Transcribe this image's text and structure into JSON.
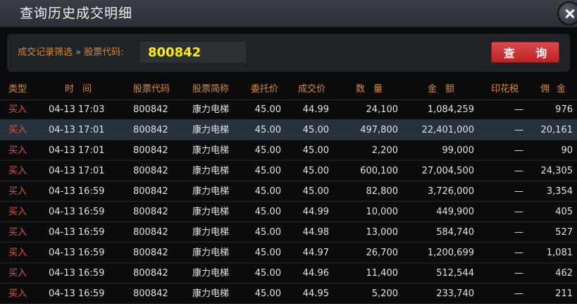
{
  "window": {
    "title": "查询历史成交明细",
    "close_icon": "close-icon"
  },
  "filter": {
    "label": "成交记录筛选",
    "separator": " » ",
    "code_label": "股票代码:",
    "code_value": "800842",
    "query_label": "查 询"
  },
  "colors": {
    "accent_orange": "#d88a3a",
    "buy_red": "#e0574a",
    "code_yellow": "#ffee00",
    "button_red": "#d03434",
    "selected_row": "#27313c"
  },
  "table": {
    "columns": [
      "类型",
      "时间",
      "股票代码",
      "股票简称",
      "委托价",
      "成交价",
      "数量",
      "金额",
      "印花税",
      "佣金"
    ],
    "rows": [
      {
        "type": "买入",
        "time": "04-13 17:03",
        "code": "800842",
        "name": "康力电梯",
        "order_price": "45.00",
        "deal_price": "44.99",
        "qty": "24,100",
        "amount": "1,084,259",
        "tax": "—",
        "commission": "976"
      },
      {
        "type": "买入",
        "time": "04-13 17:01",
        "code": "800842",
        "name": "康力电梯",
        "order_price": "45.00",
        "deal_price": "45.00",
        "qty": "497,800",
        "amount": "22,401,000",
        "tax": "—",
        "commission": "20,161"
      },
      {
        "type": "买入",
        "time": "04-13 17:01",
        "code": "800842",
        "name": "康力电梯",
        "order_price": "45.00",
        "deal_price": "45.00",
        "qty": "2,200",
        "amount": "99,000",
        "tax": "—",
        "commission": "90"
      },
      {
        "type": "买入",
        "time": "04-13 17:01",
        "code": "800842",
        "name": "康力电梯",
        "order_price": "45.00",
        "deal_price": "45.00",
        "qty": "600,100",
        "amount": "27,004,500",
        "tax": "—",
        "commission": "24,305"
      },
      {
        "type": "买入",
        "time": "04-13 16:59",
        "code": "800842",
        "name": "康力电梯",
        "order_price": "45.00",
        "deal_price": "45.00",
        "qty": "82,800",
        "amount": "3,726,000",
        "tax": "—",
        "commission": "3,354"
      },
      {
        "type": "买入",
        "time": "04-13 16:59",
        "code": "800842",
        "name": "康力电梯",
        "order_price": "45.00",
        "deal_price": "44.99",
        "qty": "10,000",
        "amount": "449,900",
        "tax": "—",
        "commission": "405"
      },
      {
        "type": "买入",
        "time": "04-13 16:59",
        "code": "800842",
        "name": "康力电梯",
        "order_price": "45.00",
        "deal_price": "44.98",
        "qty": "13,000",
        "amount": "584,740",
        "tax": "—",
        "commission": "527"
      },
      {
        "type": "买入",
        "time": "04-13 16:59",
        "code": "800842",
        "name": "康力电梯",
        "order_price": "45.00",
        "deal_price": "44.97",
        "qty": "26,700",
        "amount": "1,200,699",
        "tax": "—",
        "commission": "1,081"
      },
      {
        "type": "买入",
        "time": "04-13 16:59",
        "code": "800842",
        "name": "康力电梯",
        "order_price": "45.00",
        "deal_price": "44.96",
        "qty": "11,400",
        "amount": "512,544",
        "tax": "—",
        "commission": "462"
      },
      {
        "type": "买入",
        "time": "04-13 16:59",
        "code": "800842",
        "name": "康力电梯",
        "order_price": "45.00",
        "deal_price": "44.95",
        "qty": "5,200",
        "amount": "233,740",
        "tax": "—",
        "commission": "211"
      }
    ],
    "selected_row": 1
  }
}
